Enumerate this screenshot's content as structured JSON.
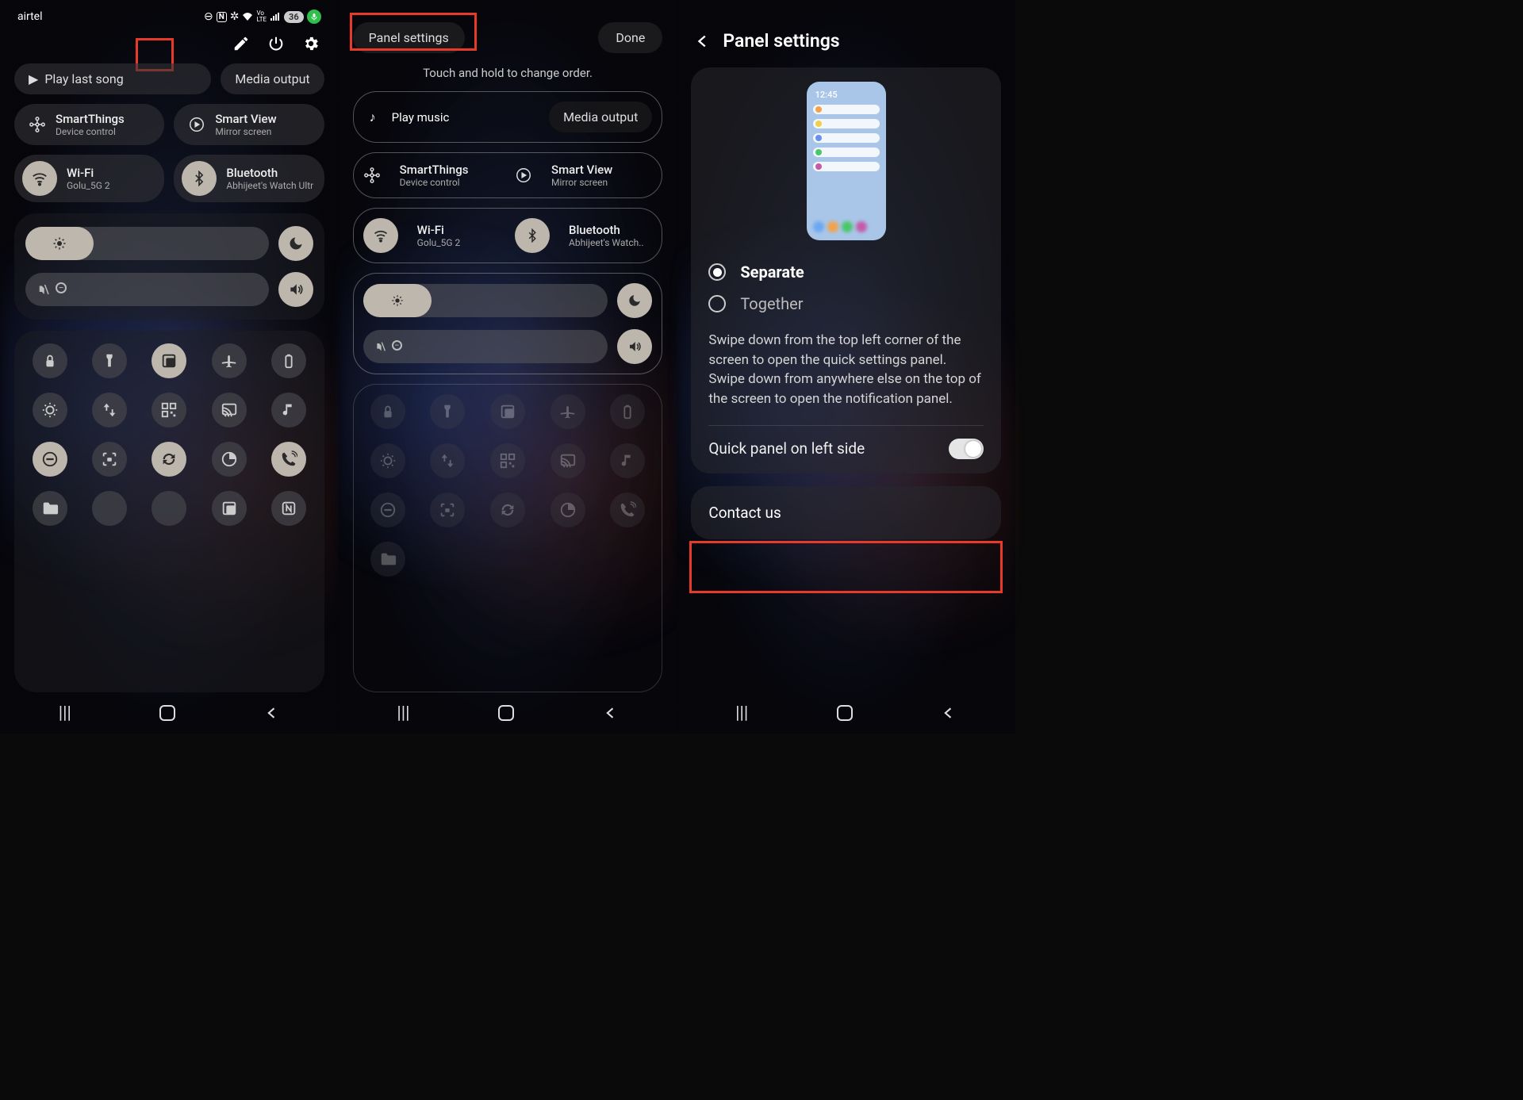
{
  "phone1": {
    "carrier": "airtel",
    "battery_pct": "36",
    "edit_aria": "Edit",
    "power_aria": "Power",
    "settings_aria": "Settings",
    "media": {
      "play_last": "Play last song",
      "output": "Media output"
    },
    "tiles": {
      "smartthings": {
        "title": "SmartThings",
        "sub": "Device control"
      },
      "smartview": {
        "title": "Smart View",
        "sub": "Mirror screen"
      },
      "wifi": {
        "title": "Wi-Fi",
        "sub": "Golu_5G 2"
      },
      "bluetooth": {
        "title": "Bluetooth",
        "sub": "Abhijeet's Watch Ultra"
      }
    },
    "grid_icons": [
      "lock",
      "flashlight",
      "multiwindow",
      "airplane",
      "battery",
      "brightness-auto",
      "updown",
      "qr",
      "cast",
      "music",
      "dnd",
      "camera-focus",
      "sync",
      "pie",
      "call-volume",
      "folder",
      "blank",
      "blank",
      "multiwindow",
      "nfc"
    ]
  },
  "phone2": {
    "chip": "Panel settings",
    "done": "Done",
    "hint": "Touch and hold to change order.",
    "media": {
      "play": "Play music",
      "output": "Media output"
    },
    "tiles": {
      "smartthings": {
        "title": "SmartThings",
        "sub": "Device control"
      },
      "smartview": {
        "title": "Smart View",
        "sub": "Mirror screen"
      },
      "wifi": {
        "title": "Wi-Fi",
        "sub": "Golu_5G 2"
      },
      "bluetooth": {
        "title": "Bluetooth",
        "sub": "Abhijeet's Watch.."
      }
    },
    "grid_icons": [
      "lock",
      "flashlight",
      "multiwindow",
      "airplane",
      "battery",
      "brightness-auto",
      "updown",
      "qr",
      "cast",
      "music",
      "dnd",
      "camera-focus",
      "sync",
      "pie",
      "call-volume",
      "folder"
    ]
  },
  "phone3": {
    "title": "Panel settings",
    "preview_time": "12:45",
    "opt_separate": "Separate",
    "opt_together": "Together",
    "description": "Swipe down from the top left corner of the screen to open the quick settings panel. Swipe down from anywhere else on the top of the screen to open the notification panel.",
    "quick_panel_left": "Quick panel on left side",
    "contact": "Contact us"
  }
}
